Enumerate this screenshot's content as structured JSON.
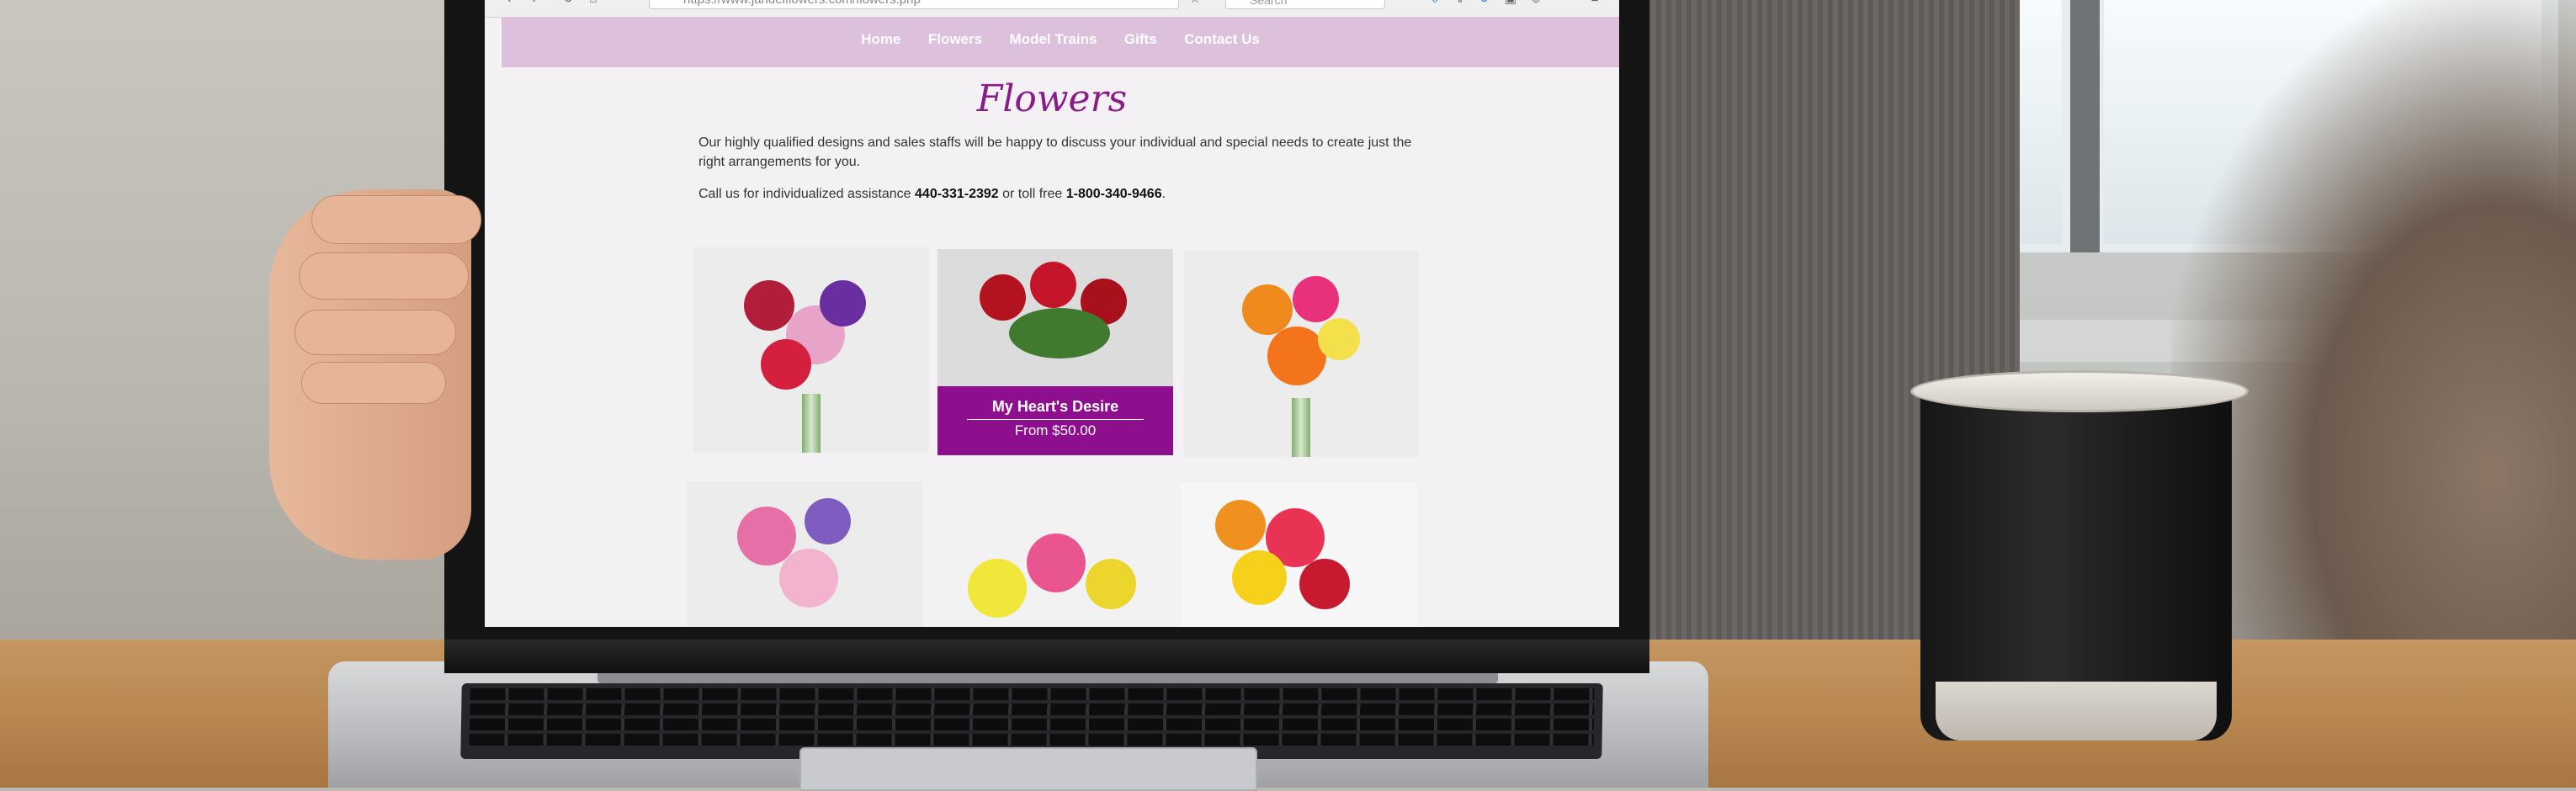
{
  "browser": {
    "url": "https://www.jandelflowers.com/flowers.php",
    "search_placeholder": "Search"
  },
  "nav": {
    "items": [
      "Home",
      "Flowers",
      "Model Trains",
      "Gifts",
      "Contact Us"
    ]
  },
  "page": {
    "title": "Flowers",
    "intro": "Our highly qualified designs and sales staffs will be happy to discuss your individual and special needs to create just the right arrangements for you.",
    "contact_prefix": "Call us for individualized assistance",
    "phone_local": "440-331-2392",
    "contact_middle": "or toll free",
    "phone_tollfree": "1-800-340-9466",
    "contact_suffix": "."
  },
  "products": [
    {
      "caption_name": "",
      "caption_price": ""
    },
    {
      "caption_name": "My Heart's Desire",
      "caption_price": "From $50.00"
    },
    {
      "caption_name": "",
      "caption_price": ""
    },
    {
      "caption_name": "",
      "caption_price": ""
    },
    {
      "caption_name": "",
      "caption_price": ""
    },
    {
      "caption_name": "",
      "caption_price": ""
    }
  ],
  "colors": {
    "nav_bg": "#dcc0dc",
    "accent": "#8e0f8e",
    "title": "#8a1c8a"
  },
  "icons": [
    "back-icon",
    "forward-icon",
    "reload-icon",
    "home-icon",
    "download-icon",
    "library-icon",
    "account-icon",
    "menu-icon"
  ]
}
